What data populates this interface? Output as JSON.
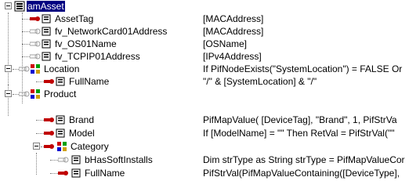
{
  "tree": {
    "root": {
      "label": "amAsset",
      "icon": "root-node-icon"
    },
    "rows": [
      {
        "name": "AssetTag",
        "value": "[MACAddress]",
        "icon": "active-key-field-icon"
      },
      {
        "name": "fv_NetworkCard01Address",
        "value": "[MACAddress]",
        "icon": "inactive-key-field-icon"
      },
      {
        "name": "fv_OS01Name",
        "value": "[OSName]",
        "icon": "inactive-key-field-icon"
      },
      {
        "name": "fv_TCPIP01Address",
        "value": "[IPv4Address]",
        "icon": "inactive-key-field-icon"
      },
      {
        "name": "Location",
        "value": "If PifNodeExists(\"SystemLocation\") = FALSE Or",
        "icon": "link-node-icon"
      },
      {
        "name": "FullName",
        "value": "\"/\" & [SystemLocation] & \"/\"",
        "icon": "active-key-field-icon"
      },
      {
        "name": "Product",
        "value": "",
        "icon": "link-node-icon"
      },
      {
        "name": "Brand",
        "value": "PifMapValue( [DeviceTag], \"Brand\", 1, PifStrVa",
        "icon": "active-key-field-icon"
      },
      {
        "name": "Model",
        "value": "If [ModelName] = \"\" Then RetVal = PifStrVal(\"\"",
        "icon": "active-key-field-icon"
      },
      {
        "name": "Category",
        "value": "",
        "icon": "link-node-icon"
      },
      {
        "name": "bHasSoftInstalls",
        "value": "Dim strType as String strType = PifMapValueCor",
        "icon": "inactive-key-field-icon"
      },
      {
        "name": "FullName",
        "value": "PifStrVal(PifMapValueContaining([DeviceType],",
        "icon": "active-key-field-icon"
      }
    ]
  },
  "colors": {
    "active_key": "#c00000",
    "inactive_key": "#b0b0b0",
    "selection": "#000080"
  }
}
